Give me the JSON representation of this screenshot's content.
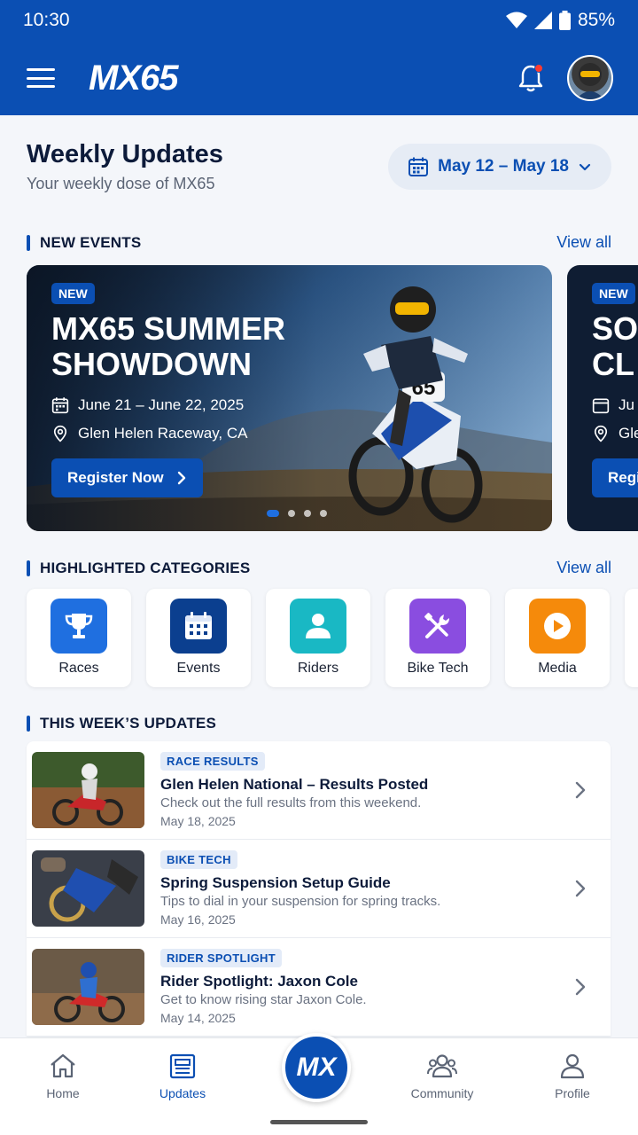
{
  "status_bar": {
    "time": "10:30",
    "battery": "85%"
  },
  "app": {
    "logo": "MX65",
    "brand_color": "#0b4fb3"
  },
  "weekly": {
    "title": "Weekly Updates",
    "subtitle": "Your weekly dose of MX65",
    "date_range": "May 12 – May 18"
  },
  "new_events": {
    "title": "NEW EVENTS",
    "view_all": "View all",
    "cards": [
      {
        "badge": "NEW",
        "title": "MX65 SUMMER SHOWDOWN",
        "date": "June 21 – June 22, 2025",
        "location": "Glen Helen Raceway, CA",
        "cta": "Register Now",
        "number_plate": "65"
      },
      {
        "badge": "NEW",
        "title": "SO CL",
        "date": "Ju",
        "location": "Gle",
        "cta": "Regi"
      }
    ]
  },
  "categories": {
    "title": "HIGHLIGHTED CATEGORIES",
    "view_all": "View all",
    "items": [
      {
        "label": "Races",
        "icon": "trophy-icon",
        "color": "#1f6fe0"
      },
      {
        "label": "Events",
        "icon": "calendar-icon",
        "color": "#0b3f8f"
      },
      {
        "label": "Riders",
        "icon": "person-icon",
        "color": "#19b8c4"
      },
      {
        "label": "Bike Tech",
        "icon": "tools-icon",
        "color": "#8a4de0"
      },
      {
        "label": "Media",
        "icon": "play-icon",
        "color": "#f58a0b"
      }
    ]
  },
  "updates": {
    "title": "THIS WEEK’S UPDATES",
    "items": [
      {
        "tag": "RACE RESULTS",
        "title": "Glen Helen National – Results Posted",
        "desc": "Check out the full results from this weekend.",
        "date": "May 18, 2025"
      },
      {
        "tag": "BIKE TECH",
        "title": "Spring Suspension Setup Guide",
        "desc": "Tips to dial in your suspension for spring tracks.",
        "date": "May 16, 2025"
      },
      {
        "tag": "RIDER SPOTLIGHT",
        "title": "Rider Spotlight: Jaxon Cole",
        "desc": "Get to know rising star Jaxon Cole.",
        "date": "May 14, 2025"
      }
    ]
  },
  "bottom_nav": {
    "home": "Home",
    "updates": "Updates",
    "center": "MX",
    "community": "Community",
    "profile": "Profile"
  }
}
